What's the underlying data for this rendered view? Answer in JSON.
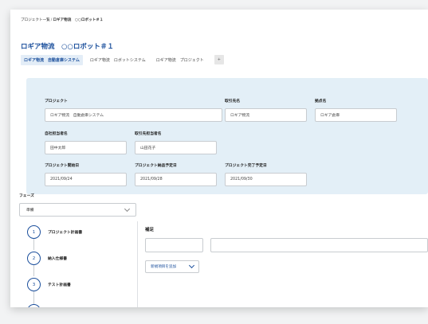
{
  "breadcrumb": {
    "parent": "プロジェクト一覧",
    "separator": "/",
    "current": "ロギア物流　○○ロボット＃１"
  },
  "page_title": "ロギア物流　○○ロボット＃１",
  "tabs": [
    {
      "label": "ロギア物流　自動倉庫システム",
      "active": true
    },
    {
      "label": "ロギア物流　ロボットシステム",
      "active": false
    },
    {
      "label": "ロギア物流　プロジェクト",
      "active": false
    }
  ],
  "tab_add_label": "+",
  "fields": {
    "project": {
      "label": "プロジェクト",
      "value": "ロギア物流　自動倉庫システム"
    },
    "client": {
      "label": "取引先名",
      "value": "ロギア物流"
    },
    "site": {
      "label": "拠点名",
      "value": "ロギア倉庫"
    },
    "own_person": {
      "label": "自社担当者名",
      "value": "田中太郎"
    },
    "client_person": {
      "label": "取引先担当者名",
      "value": "山田花子"
    },
    "start_date": {
      "label": "プロジェクト開始日",
      "value": "2021/09/24"
    },
    "delivery_date": {
      "label": "プロジェクト納品予定日",
      "value": "2021/09/28"
    },
    "end_date": {
      "label": "プロジェクト完了予定日",
      "value": "2021/09/30"
    }
  },
  "phase": {
    "label": "フェーズ",
    "selected": "準備"
  },
  "steps": [
    {
      "number": "1",
      "label": "プロジェクト計画書"
    },
    {
      "number": "2",
      "label": "納入仕様書"
    },
    {
      "number": "3",
      "label": "テスト計画書"
    }
  ],
  "supplement": {
    "title": "補足",
    "add_item_label": "新規項目を追加"
  },
  "colors": {
    "accent": "#1b4f9c",
    "panel_bg": "#e3eff7",
    "active_tab_bg": "#e3edf7"
  }
}
